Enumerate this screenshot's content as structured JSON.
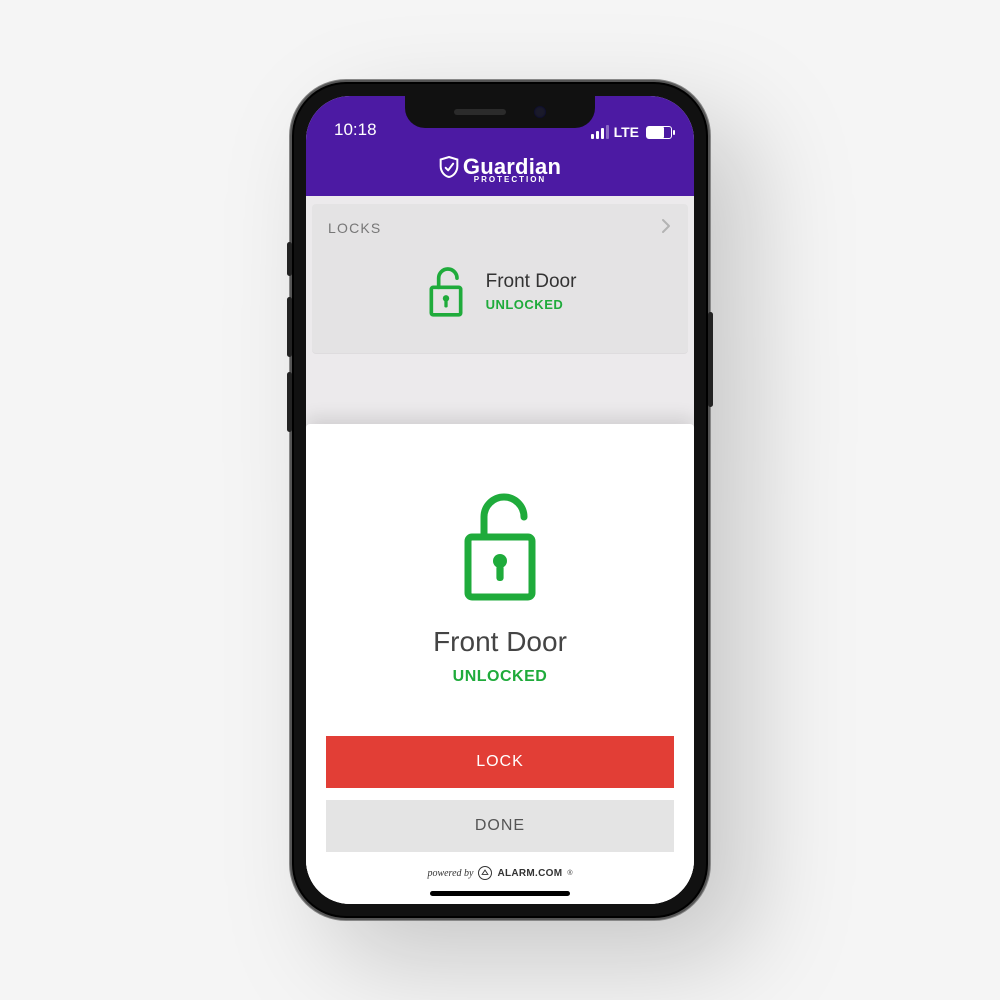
{
  "colors": {
    "purple": "#4c1aa3",
    "green": "#1fab3b",
    "red": "#e23e36"
  },
  "statusbar": {
    "time": "10:18",
    "network_label": "LTE"
  },
  "brand": {
    "name": "Guardian",
    "subtitle": "PROTECTION"
  },
  "locks_card": {
    "header": "LOCKS",
    "item": {
      "name": "Front Door",
      "state": "UNLOCKED"
    }
  },
  "modal": {
    "name": "Front Door",
    "state": "UNLOCKED",
    "lock_button": "LOCK",
    "done_button": "DONE"
  },
  "footer": {
    "powered_by": "powered by",
    "provider": "ALARM.COM"
  }
}
